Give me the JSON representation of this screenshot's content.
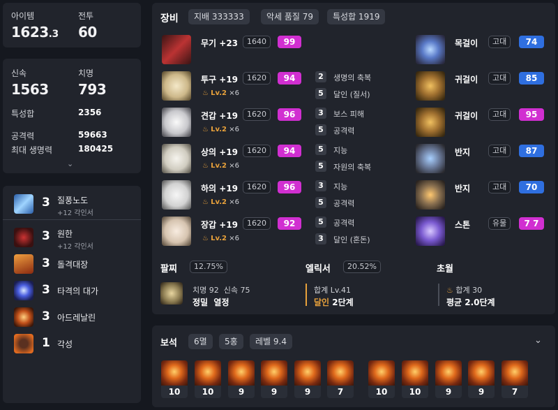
{
  "stats_top": {
    "item_label": "아이템",
    "item_value": "1623",
    "item_value_dec": ".3",
    "combat_label": "전투",
    "combat_value": "60"
  },
  "stats": {
    "swift_label": "신속",
    "swift_value": "1563",
    "crit_label": "치명",
    "crit_value": "793",
    "total_label": "특성합",
    "total_value": "2356",
    "atk_label": "공격력",
    "atk_value": "59663",
    "hp_label": "최대 생명력",
    "hp_value": "180425"
  },
  "skills": [
    {
      "level": "3",
      "name": "질풍노도",
      "sub": "+12 각인서"
    },
    {
      "level": "3",
      "name": "원한",
      "sub": "+12 각인서"
    },
    {
      "level": "3",
      "name": "돌격대장",
      "sub": ""
    },
    {
      "level": "3",
      "name": "타격의 대가",
      "sub": ""
    },
    {
      "level": "3",
      "name": "아드레날린",
      "sub": ""
    },
    {
      "level": "1",
      "name": "각성",
      "sub": ""
    }
  ],
  "equip_header": {
    "title": "장비",
    "tags": [
      "지배 333333",
      "악세 품질 79",
      "특성합 1919"
    ]
  },
  "gear": [
    {
      "name": "무기 +23",
      "ilvl": "1640",
      "quality": "99",
      "lv": "",
      "mult": "",
      "opts": []
    },
    {
      "name": "투구 +19",
      "ilvl": "1620",
      "quality": "94",
      "lv": "Lv.2",
      "mult": "×6",
      "opts": [
        {
          "n": "2",
          "t": "생명의 축복"
        },
        {
          "n": "5",
          "t": "달인 (질서)"
        }
      ]
    },
    {
      "name": "견갑 +19",
      "ilvl": "1620",
      "quality": "96",
      "lv": "Lv.2",
      "mult": "×6",
      "opts": [
        {
          "n": "3",
          "t": "보스 피해"
        },
        {
          "n": "5",
          "t": "공격력"
        }
      ]
    },
    {
      "name": "상의 +19",
      "ilvl": "1620",
      "quality": "94",
      "lv": "Lv.2",
      "mult": "×6",
      "opts": [
        {
          "n": "5",
          "t": "지능"
        },
        {
          "n": "5",
          "t": "자원의 축복"
        }
      ]
    },
    {
      "name": "하의 +19",
      "ilvl": "1620",
      "quality": "96",
      "lv": "Lv.2",
      "mult": "×6",
      "opts": [
        {
          "n": "3",
          "t": "지능"
        },
        {
          "n": "5",
          "t": "공격력"
        }
      ]
    },
    {
      "name": "장갑 +19",
      "ilvl": "1620",
      "quality": "92",
      "lv": "Lv.2",
      "mult": "×6",
      "opts": [
        {
          "n": "5",
          "t": "공격력"
        },
        {
          "n": "3",
          "t": "달인 (혼돈)"
        }
      ]
    }
  ],
  "acc": [
    {
      "name": "목걸이",
      "grade": "고대",
      "quality": "74"
    },
    {
      "name": "귀걸이",
      "grade": "고대",
      "quality": "85"
    },
    {
      "name": "귀걸이",
      "grade": "고대",
      "quality": "95"
    },
    {
      "name": "반지",
      "grade": "고대",
      "quality": "87"
    },
    {
      "name": "반지",
      "grade": "고대",
      "quality": "70"
    },
    {
      "name": "스톤",
      "grade": "유물",
      "quality": "7 7"
    }
  ],
  "bracelet": {
    "title": "팔찌",
    "pct": "12.75%",
    "line1": "치명 92  신속 75",
    "line2": "정밀  열정"
  },
  "elixir": {
    "title": "엘릭서",
    "pct": "20.52%",
    "line1": "합계 Lv.41",
    "line2a": "달인",
    "line2b": "2단계"
  },
  "transcend": {
    "title": "초월",
    "line1": "합계 30",
    "line2": "평균 2.0단계"
  },
  "gems": {
    "title": "보석",
    "tags": [
      "6멸",
      "5홍",
      "레벨 9.4"
    ],
    "values": [
      "10",
      "10",
      "9",
      "9",
      "9",
      "7",
      "10",
      "10",
      "9",
      "9",
      "7"
    ]
  },
  "colors": {
    "quality_magenta": "#d12fd1",
    "quality_blue": "#2f6fe0",
    "accent_orange": "#e9a23b"
  }
}
